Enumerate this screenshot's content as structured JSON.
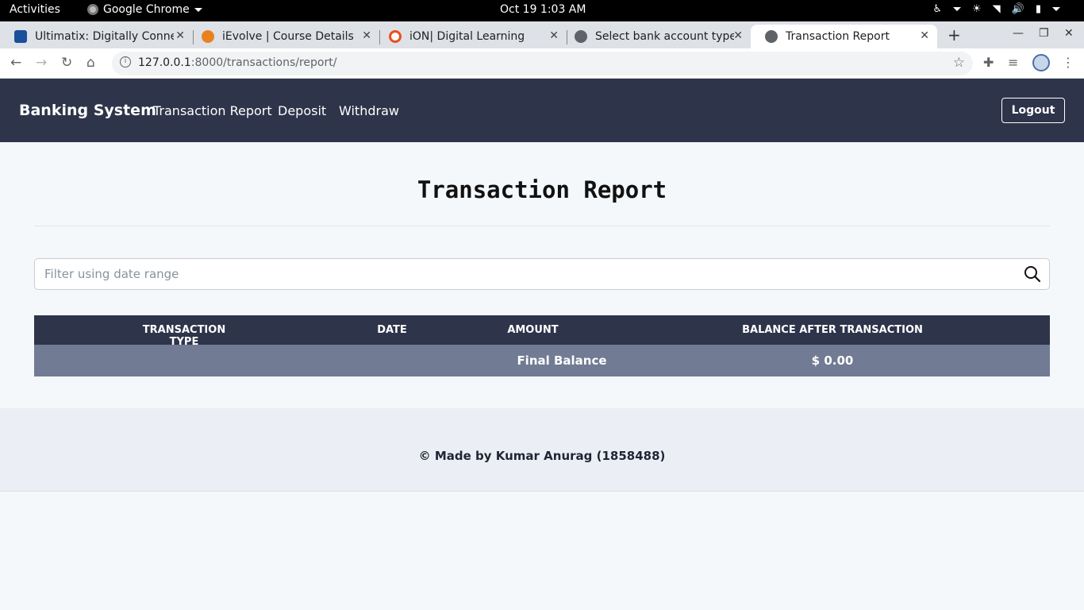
{
  "system": {
    "activities": "Activities",
    "app_name": "Google Chrome",
    "clock": "Oct 19   1:03 AM"
  },
  "browser": {
    "tabs": [
      {
        "title": "Ultimatix: Digitally Conne",
        "fav_color": "#1a4f9c"
      },
      {
        "title": "iEvolve | Course Details",
        "fav_color": "#e8821e"
      },
      {
        "title": "iON| Digital Learning",
        "fav_color": "#e8501e"
      },
      {
        "title": "Select bank account type",
        "fav_color": "#5f6368"
      },
      {
        "title": "Transaction Report",
        "fav_color": "#5f6368"
      }
    ],
    "url_host": "127.0.0.1",
    "url_path": ":8000/transactions/report/"
  },
  "navbar": {
    "brand": "Banking System",
    "links": [
      "Transaction Report",
      "Deposit",
      "Withdraw"
    ],
    "logout": "Logout"
  },
  "page": {
    "title": "Transaction Report",
    "search_placeholder": "Filter using date range"
  },
  "table": {
    "headers": [
      "TRANSACTION TYPE",
      "DATE",
      "AMOUNT",
      "BALANCE AFTER TRANSACTION"
    ],
    "final_label": "Final Balance",
    "final_value": "$ 0.00"
  },
  "footer": {
    "text": "© Made by Kumar Anurag (1858488)"
  }
}
